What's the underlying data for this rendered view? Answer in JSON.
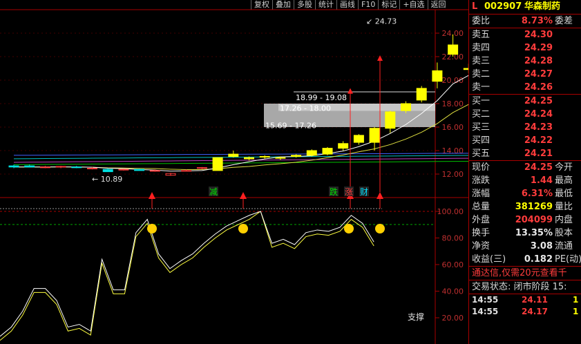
{
  "toolbar": [
    "复权",
    "叠加",
    "多股",
    "统计",
    "画线",
    "F10",
    "标记",
    "+自选",
    "返回"
  ],
  "stock": {
    "flag": "L",
    "code": "002907",
    "name": "华森制药"
  },
  "weibi": {
    "label": "委比",
    "value": "8.73%",
    "label2": "委差"
  },
  "asks": [
    {
      "label": "卖五",
      "price": "24.30"
    },
    {
      "label": "卖四",
      "price": "24.29"
    },
    {
      "label": "卖三",
      "price": "24.28"
    },
    {
      "label": "卖二",
      "price": "24.27"
    },
    {
      "label": "卖一",
      "price": "24.26"
    }
  ],
  "bids": [
    {
      "label": "买一",
      "price": "24.25"
    },
    {
      "label": "买二",
      "price": "24.24"
    },
    {
      "label": "买三",
      "price": "24.23"
    },
    {
      "label": "买四",
      "price": "24.22"
    },
    {
      "label": "买五",
      "price": "24.21"
    }
  ],
  "quote": [
    {
      "label": "现价",
      "value": "24.25",
      "label2": "今开",
      "color": "red"
    },
    {
      "label": "涨跌",
      "value": "1.44",
      "label2": "最高",
      "color": "red"
    },
    {
      "label": "涨幅",
      "value": "6.31%",
      "label2": "最低",
      "color": "red"
    },
    {
      "label": "总量",
      "value": "381269",
      "label2": "量比",
      "color": "yellow"
    },
    {
      "label": "外盘",
      "value": "204099",
      "label2": "内盘",
      "color": "red"
    },
    {
      "label": "换手",
      "value": "13.35%",
      "label2": "股本",
      "color": "white"
    },
    {
      "label": "净资",
      "value": "3.08",
      "label2": "流通",
      "color": "white"
    },
    {
      "label": "收益(三)",
      "value": "0.182",
      "label2": "PE(动)",
      "color": "white"
    }
  ],
  "ad": "通达信,仅需20元查看千",
  "trade_status": "交易状态: 闭市阶段 15:",
  "ticks": [
    {
      "time": "14:55",
      "price": "24.11",
      "vol": "1"
    },
    {
      "time": "14:55",
      "price": "24.17",
      "vol": "1"
    }
  ],
  "chart_data": {
    "type": "candlestick",
    "price_axis": {
      "ticks": [
        12,
        14,
        16,
        18,
        20,
        22,
        24
      ],
      "labels": [
        "12.00",
        "14.00",
        "16.00",
        "18.00",
        "20.00",
        "22.00",
        "24.00"
      ]
    },
    "osc_axis": {
      "ticks": [
        20,
        40,
        60,
        80,
        100
      ],
      "labels": [
        "20.00",
        "40.00",
        "60.00",
        "80.00",
        "100.00"
      ]
    },
    "candles": [
      [
        12.7,
        12.8,
        12.5,
        12.6
      ],
      [
        12.7,
        12.8,
        12.6,
        12.6
      ],
      [
        12.55,
        12.7,
        12.5,
        12.6
      ],
      [
        12.6,
        12.7,
        12.5,
        12.65
      ],
      [
        12.6,
        12.7,
        12.5,
        12.55
      ],
      [
        12.5,
        12.6,
        12.4,
        12.5
      ],
      [
        12.4,
        12.5,
        12.2,
        12.2
      ],
      [
        12.35,
        12.45,
        12.3,
        12.4
      ],
      [
        12.4,
        12.45,
        12.3,
        12.3
      ],
      [
        12.3,
        12.4,
        12.2,
        12.3
      ],
      [
        11.9,
        12.1,
        11.85,
        12.05
      ],
      [
        12.3,
        12.4,
        12.25,
        12.3
      ],
      [
        12.5,
        12.6,
        12.4,
        12.55
      ],
      [
        12.3,
        13.4,
        12.3,
        13.4
      ],
      [
        13.5,
        14.0,
        13.4,
        13.7
      ],
      [
        13.4,
        13.5,
        13.15,
        13.3
      ],
      [
        13.5,
        13.6,
        13.3,
        13.5
      ],
      [
        13.4,
        13.5,
        13.2,
        13.4
      ],
      [
        13.5,
        13.7,
        13.4,
        13.6
      ],
      [
        13.6,
        14.1,
        13.5,
        14.0
      ],
      [
        13.7,
        14.3,
        13.6,
        14.2
      ],
      [
        14.2,
        14.8,
        14.0,
        14.6
      ],
      [
        14.7,
        15.4,
        14.5,
        15.3
      ],
      [
        14.7,
        16.0,
        14.0,
        15.9
      ],
      [
        15.9,
        17.4,
        15.5,
        17.3
      ],
      [
        17.4,
        18.2,
        17.2,
        18.0
      ],
      [
        18.3,
        19.5,
        18.1,
        19.3
      ],
      [
        19.9,
        21.5,
        19.3,
        20.8
      ],
      [
        22.2,
        23.9,
        22.0,
        23.0
      ],
      [
        21.0,
        21.4,
        20.6,
        20.9
      ],
      [
        20.9,
        21.0,
        20.5,
        20.8
      ],
      [
        20.2,
        22.8,
        20.1,
        22.8
      ],
      [
        22.8,
        24.1,
        21.7,
        22.9
      ],
      [
        22.2,
        24.73,
        22.2,
        23.8
      ]
    ],
    "labels": {
      "low": "10.89",
      "high": "24.73",
      "zones": [
        "18.99 - 19.08",
        "17.26 - 18.00",
        "15.69 - 17.26"
      ]
    },
    "signals": [
      "减",
      "跌",
      "涨",
      "财"
    ],
    "osc_label": "支撑",
    "osc": [
      3,
      10,
      22,
      39,
      39,
      30,
      10,
      12,
      7,
      61,
      38,
      38,
      81,
      91,
      65,
      54,
      60,
      65,
      73,
      80,
      86,
      90,
      94,
      100,
      73,
      76,
      72,
      81,
      83,
      82,
      85,
      94,
      88,
      74
    ]
  }
}
